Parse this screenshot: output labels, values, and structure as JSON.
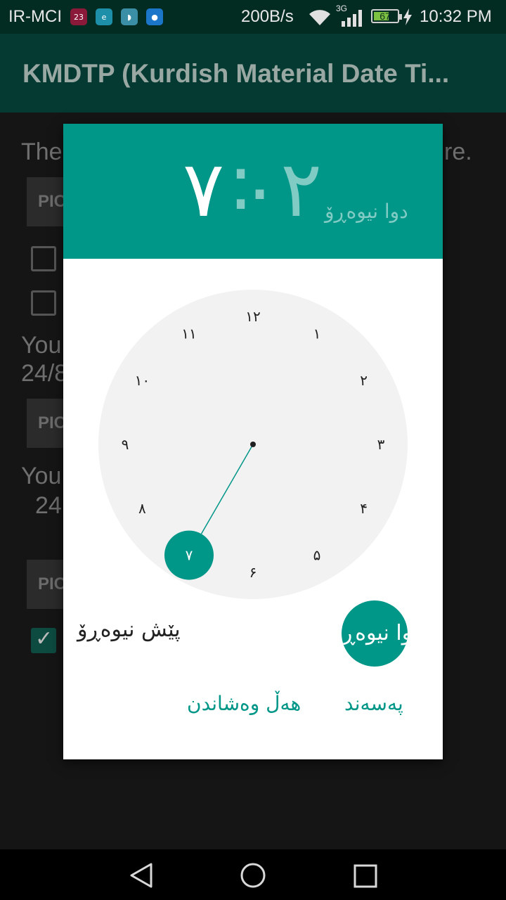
{
  "status_bar": {
    "carrier": "IR-MCI",
    "notif_badge": "23",
    "speed": "200B/s",
    "network": "3G",
    "battery": "67",
    "battery_level": 0.67,
    "time": "10:32 PM"
  },
  "app_bar": {
    "title": "KMDTP (Kurdish Material Date Ti..."
  },
  "background": {
    "line1": "The",
    "line1_end": "re.",
    "pick_label": "PIC",
    "line2a": "You",
    "line2b": "24/8",
    "line3a": "You",
    "line3b": "24"
  },
  "dialog": {
    "header": {
      "hour": "۷",
      "colon": ":",
      "minute": "۰۲",
      "ampm": "دوا نیوەڕۆ"
    },
    "clock": {
      "numbers": [
        "۱۲",
        "۱",
        "۲",
        "۳",
        "۴",
        "۵",
        "۶",
        "۷",
        "۸",
        "۹",
        "۱۰",
        "۱۱"
      ],
      "selected": "۷"
    },
    "am_label": "پێش نیوەڕۆ",
    "pm_label": "دوا نیوەڕۆ",
    "cancel_label": "هەڵ وەشاندن",
    "ok_label": "پەسەند"
  },
  "colors": {
    "accent": "#009688",
    "accent_light": "#80cbc4",
    "appbar": "#043a31",
    "statusbar": "#022b22"
  }
}
